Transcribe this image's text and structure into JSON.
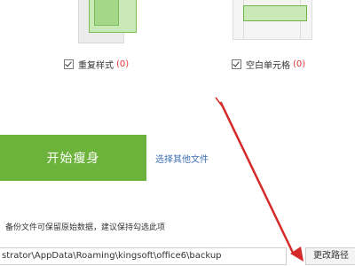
{
  "options": {
    "duplicate_style": {
      "label": "重复样式",
      "count": "(0)"
    },
    "blank_cells": {
      "label": "空白单元格",
      "count": "(0)"
    }
  },
  "actions": {
    "start_label": "开始瘦身",
    "choose_other_label": "选择其他文件"
  },
  "backup": {
    "notice": "备份文件可保留原始数据，建议保持勾选此项",
    "path_value": "strator\\AppData\\Roaming\\kingsoft\\office6\\backup",
    "change_path_label": "更改路径"
  },
  "colors": {
    "accent_green": "#6bb33a",
    "count_red": "#e53333",
    "link_blue": "#3f6fb5",
    "annotation_arrow": "#d42a2a"
  }
}
